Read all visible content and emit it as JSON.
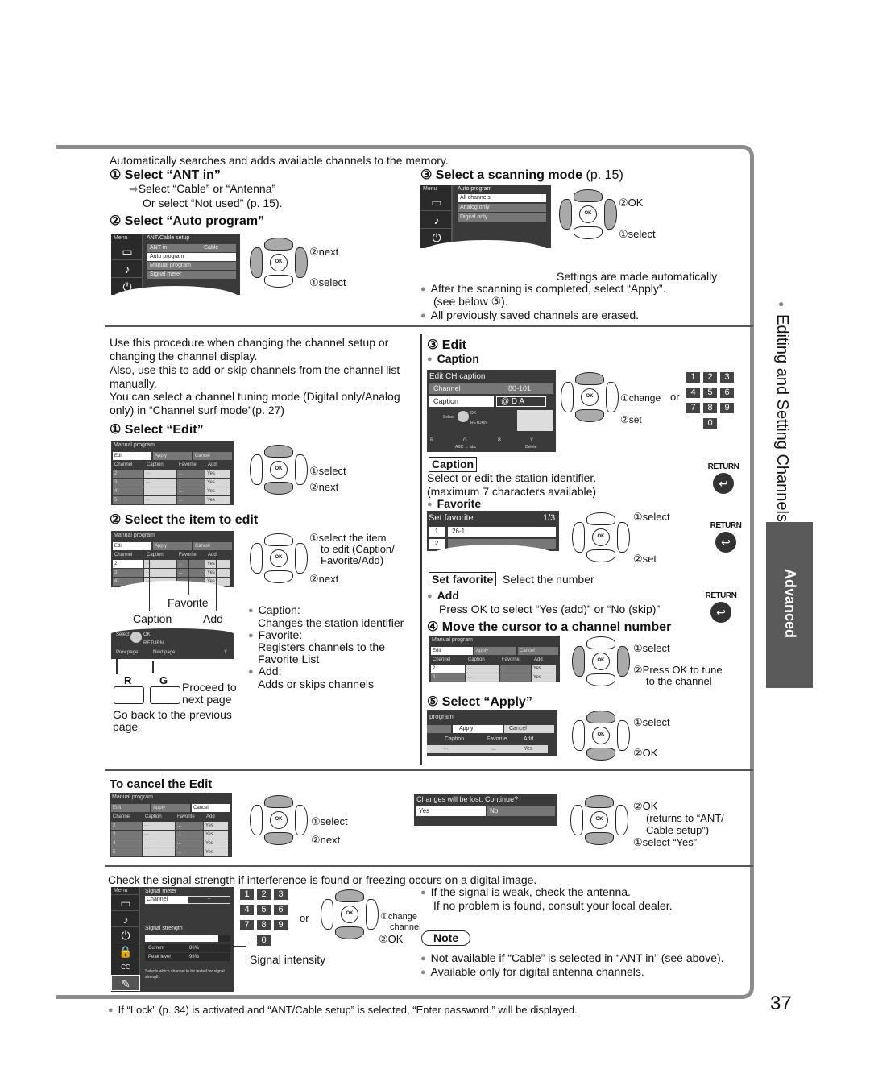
{
  "intro": "Automatically searches and adds available channels to the memory.",
  "auto": {
    "step1_title": "① Select “ANT in”",
    "step1_sub1": "Select “Cable” or “Antenna”",
    "step1_sub2": "Or select “Not used” (p. 15).",
    "step2_title": "② Select “Auto program”",
    "step3_title": "③ Select a scanning mode",
    "step3_ref": "(p. 15)",
    "screen1": {
      "menu": "Menu",
      "title": "ANT/Cable setup",
      "items": [
        "ANT in",
        "Auto program",
        "Manual program",
        "Signal meter"
      ],
      "ant_value": "Cable"
    },
    "screen2": {
      "menu": "Menu",
      "title": "Auto program",
      "items": [
        "All channels",
        "Analog only",
        "Digital only"
      ]
    },
    "callout_next": "②next",
    "callout_select": "①select",
    "callout_ok": "②OK",
    "callout_select2": "①select",
    "settings_auto": "Settings are made automatically",
    "bullet1": "After the scanning is completed, select “Apply”.",
    "bullet1b": "(see below ⑤).",
    "bullet2": "All previously saved channels are erased."
  },
  "manual": {
    "desc1": "Use this procedure when changing the channel setup or",
    "desc2": "changing the channel display.",
    "desc3": "Also, use this to add or skip channels from the channel list",
    "desc4": "manually.",
    "desc5": "You can select a channel tuning mode (Digital only/Analog",
    "desc6": "only) in “Channel surf mode”(p. 27)",
    "step1_title": "① Select “Edit”",
    "step2_title": "② Select the item to edit",
    "table": {
      "title": "Manual program",
      "tabs": [
        "Edit",
        "Apply",
        "Cancel"
      ],
      "headers": [
        "Channel",
        "Caption",
        "Favorite",
        "Add"
      ],
      "rows": [
        [
          "2",
          "···",
          "...",
          "Yes"
        ],
        [
          "3",
          "···",
          "...",
          "Yes"
        ],
        [
          "4",
          "···",
          "...",
          "Yes"
        ],
        [
          "5",
          "···",
          "...",
          "Yes"
        ]
      ]
    },
    "s1_select": "①select",
    "s1_next": "②next",
    "s2_select1": "①select the item",
    "s2_select2": "to edit (Caption/",
    "s2_select3": "Favorite/Add)",
    "s2_next": "②next",
    "label_favorite": "Favorite",
    "label_caption": "Caption",
    "label_add": "Add",
    "nav_screen": {
      "select": "Select",
      "ok": "OK",
      "return": "RETURN",
      "prev": "Prev page",
      "next": "Next page",
      "y": "Y"
    },
    "key_r": "R",
    "key_g": "G",
    "proceed1": "Proceed to",
    "proceed2": "next page",
    "goback1": "Go back to the previous",
    "goback2": "page",
    "defs": [
      {
        "term": "Caption:",
        "desc": "Changes the station identifier"
      },
      {
        "term": "Favorite:",
        "desc1": "Registers channels to the",
        "desc2": "Favorite List"
      },
      {
        "term": "Add:",
        "desc": "Adds or skips channels"
      }
    ]
  },
  "edit": {
    "step3_title": "③ Edit",
    "caption_head": "Caption",
    "caption_screen": {
      "title": "Edit CH caption",
      "channel_label": "Channel",
      "channel_value": "80-101",
      "caption_label": "Caption",
      "caption_value": "@ D A",
      "select": "Select",
      "ok": "OK",
      "return": "RETURN",
      "r": "R",
      "g": "G",
      "b": "B",
      "y": "Y",
      "abc": "ABC → abc",
      "delete": "Delete"
    },
    "change": "①change",
    "or": "or",
    "set": "②set",
    "keys": [
      "1",
      "2",
      "3",
      "4",
      "5",
      "6",
      "7",
      "8",
      "9",
      "0"
    ],
    "caption_box": "Caption",
    "caption_desc1": "Select or edit the station identifier.",
    "caption_desc2": "(maximum 7 characters available)",
    "return_label": "RETURN",
    "favorite_head": "Favorite",
    "fav_screen": {
      "title": "Set favorite",
      "page": "1/3",
      "row1_num": "1",
      "row1_val": "26-1",
      "row2_num": "2"
    },
    "fav_select": "①select",
    "fav_set": "②set",
    "setfav_box": "Set favorite",
    "setfav_desc": "Select the number",
    "add_head": "Add",
    "add_desc": "Press OK to select “Yes (add)” or “No (skip)”",
    "step4_title": "④ Move the cursor to a channel number",
    "s4_select": "①select",
    "s4_ok1": "②Press OK to tune",
    "s4_ok2": "to the channel",
    "step5_title": "⑤ Select “Apply”",
    "s5_title_partial": "program",
    "s5_select": "①select",
    "s5_ok": "②OK"
  },
  "cancel": {
    "title": "To cancel the Edit",
    "select": "①select",
    "next": "②next",
    "dialog": {
      "text": "Changes will be lost. Continue?",
      "yes": "Yes",
      "no": "No"
    },
    "ok": "②OK",
    "returns1": "(returns to “ANT/",
    "returns2": "Cable setup”)",
    "select_yes": "①select “Yes”"
  },
  "signal": {
    "intro": "Check the signal strength if interference is found or freezing occurs on a digital image.",
    "screen": {
      "menu": "Menu",
      "title": "Signal  meter",
      "channel": "Channel",
      "channel_val": "--",
      "strength": "Signal  strength",
      "current_label": "Current",
      "current_val": "86%",
      "peak_label": "Peak level",
      "peak_val": "98%",
      "help": "Selects which channel to be tested for signal strength.",
      "current_fraction": 0.86
    },
    "or": "or",
    "change1": "①change",
    "change2": "channel",
    "ok": "②OK",
    "intensity": "Signal intensity",
    "b1": "If the signal is weak, check the antenna.",
    "b1b": "If no problem is found, consult your local dealer.",
    "note": "Note",
    "n1": "Not available if “Cable” is selected in “ANT in” (see above).",
    "n2": "Available only for digital antenna channels."
  },
  "footer": "If “Lock” (p. 34) is activated and “ANT/Cable setup” is selected, “Enter password.” will be displayed.",
  "page_number": "37",
  "side": {
    "section": "Editing and Setting Channels",
    "tab": "Advanced"
  }
}
